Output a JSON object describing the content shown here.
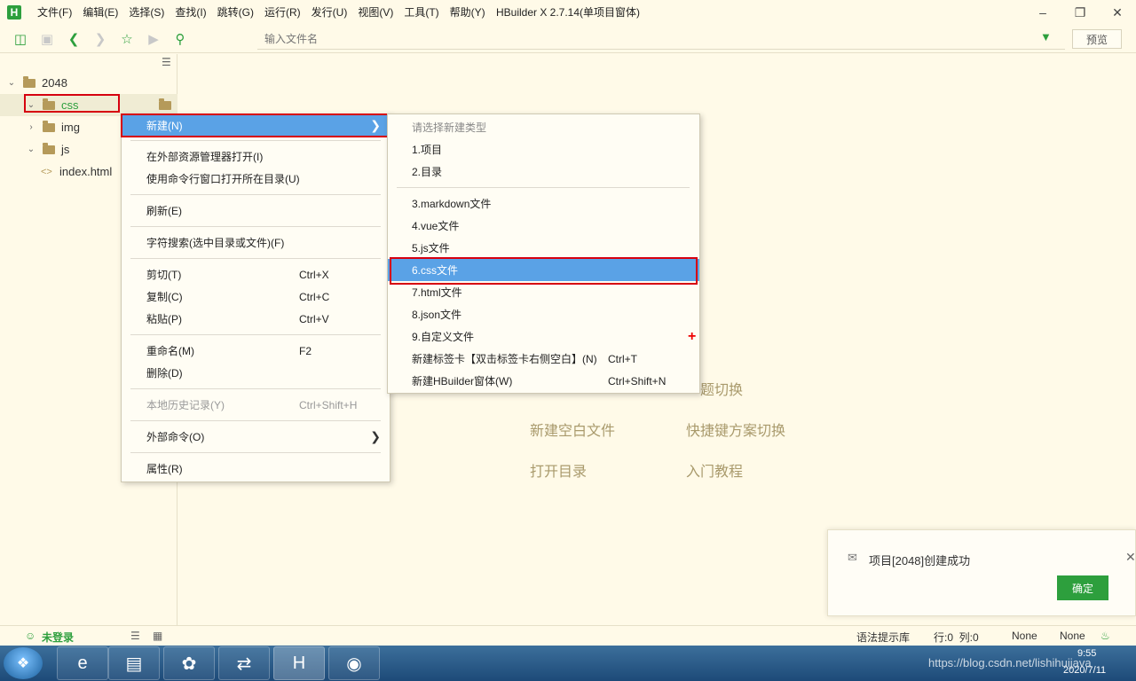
{
  "app": {
    "logo": "H",
    "title": "HBuilder X 2.7.14(单项目窗体)"
  },
  "menubar": [
    "文件(F)",
    "编辑(E)",
    "选择(S)",
    "查找(I)",
    "跳转(G)",
    "运行(R)",
    "发行(U)",
    "视图(V)",
    "工具(T)",
    "帮助(Y)"
  ],
  "toolbar": {
    "search_placeholder": "输入文件名",
    "preview_label": "预览"
  },
  "project_tree": {
    "root": "2048",
    "items": [
      "css",
      "img",
      "js",
      "index.html"
    ]
  },
  "context_menu": {
    "new": "新建(N)",
    "open_explorer": "在外部资源管理器打开(I)",
    "open_cmd": "使用命令行窗口打开所在目录(U)",
    "refresh": "刷新(E)",
    "search": "字符搜索(选中目录或文件)(F)",
    "cut": "剪切(T)",
    "cut_key": "Ctrl+X",
    "copy": "复制(C)",
    "copy_key": "Ctrl+C",
    "paste": "粘贴(P)",
    "paste_key": "Ctrl+V",
    "rename": "重命名(M)",
    "rename_key": "F2",
    "delete": "删除(D)",
    "history": "本地历史记录(Y)",
    "history_key": "Ctrl+Shift+H",
    "external": "外部命令(O)",
    "properties": "属性(R)"
  },
  "submenu": {
    "header": "请选择新建类型",
    "project": "1.项目",
    "directory": "2.目录",
    "markdown": "3.markdown文件",
    "vue": "4.vue文件",
    "js": "5.js文件",
    "css": "6.css文件",
    "html": "7.html文件",
    "json": "8.json文件",
    "custom": "9.自定义文件",
    "new_tab": "新建标签卡【双击标签卡右侧空白】(N)",
    "new_tab_key": "Ctrl+T",
    "new_window": "新建HBuilder窗体(W)",
    "new_window_key": "Ctrl+Shift+N"
  },
  "welcome": {
    "theme_switch_partial": "题切换",
    "new_blank_file": "新建空白文件",
    "shortcut_scheme": "快捷键方案切换",
    "open_dir": "打开目录",
    "tutorial": "入门教程"
  },
  "notification": {
    "message": "项目[2048]创建成功",
    "ok": "确定"
  },
  "statusbar": {
    "login": "未登录",
    "syntax_lib": "语法提示库",
    "position": "行:0  列:0",
    "encoding": "None",
    "type": "None"
  },
  "taskbar": {
    "tray_url": "https://blog.csdn.net/lishihuijava",
    "time": "9:55",
    "date": "2020/7/11"
  },
  "colors": {
    "accent_green": "#2d9f3d",
    "highlight_blue": "#5aa2e6",
    "annotation_red": "#d6000f",
    "background": "#fffae8"
  }
}
